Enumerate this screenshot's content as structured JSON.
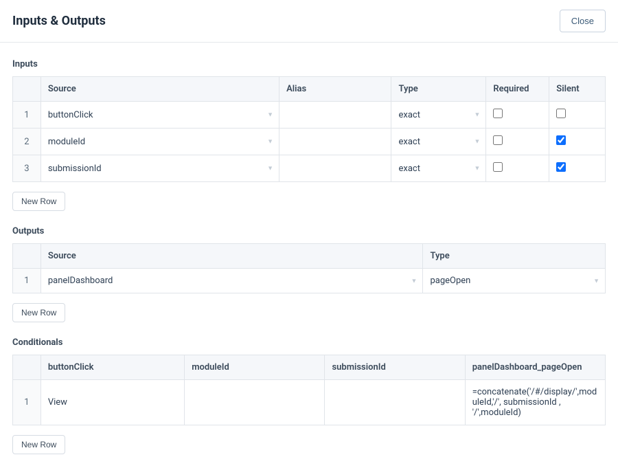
{
  "header": {
    "title": "Inputs & Outputs",
    "close_label": "Close"
  },
  "inputs": {
    "label": "Inputs",
    "columns": {
      "source": "Source",
      "alias": "Alias",
      "type": "Type",
      "required": "Required",
      "silent": "Silent"
    },
    "rows": [
      {
        "n": "1",
        "source": "buttonClick",
        "alias": "",
        "type": "exact",
        "required": false,
        "silent": false
      },
      {
        "n": "2",
        "source": "moduleId",
        "alias": "",
        "type": "exact",
        "required": false,
        "silent": true
      },
      {
        "n": "3",
        "source": "submissionId",
        "alias": "",
        "type": "exact",
        "required": false,
        "silent": true
      }
    ],
    "new_row_label": "New Row"
  },
  "outputs": {
    "label": "Outputs",
    "columns": {
      "source": "Source",
      "type": "Type"
    },
    "rows": [
      {
        "n": "1",
        "source": "panelDashboard",
        "type": "pageOpen"
      }
    ],
    "new_row_label": "New Row"
  },
  "conditionals": {
    "label": "Conditionals",
    "columns": {
      "buttonClick": "buttonClick",
      "moduleId": "moduleId",
      "submissionId": "submissionId",
      "panel": "panelDashboard_pageOpen"
    },
    "rows": [
      {
        "n": "1",
        "buttonClick": "View",
        "moduleId": "",
        "submissionId": "",
        "panel": "=concatenate('/#/display/',moduleId,'/', submissionId , '/',moduleId)"
      }
    ],
    "new_row_label": "New Row"
  }
}
